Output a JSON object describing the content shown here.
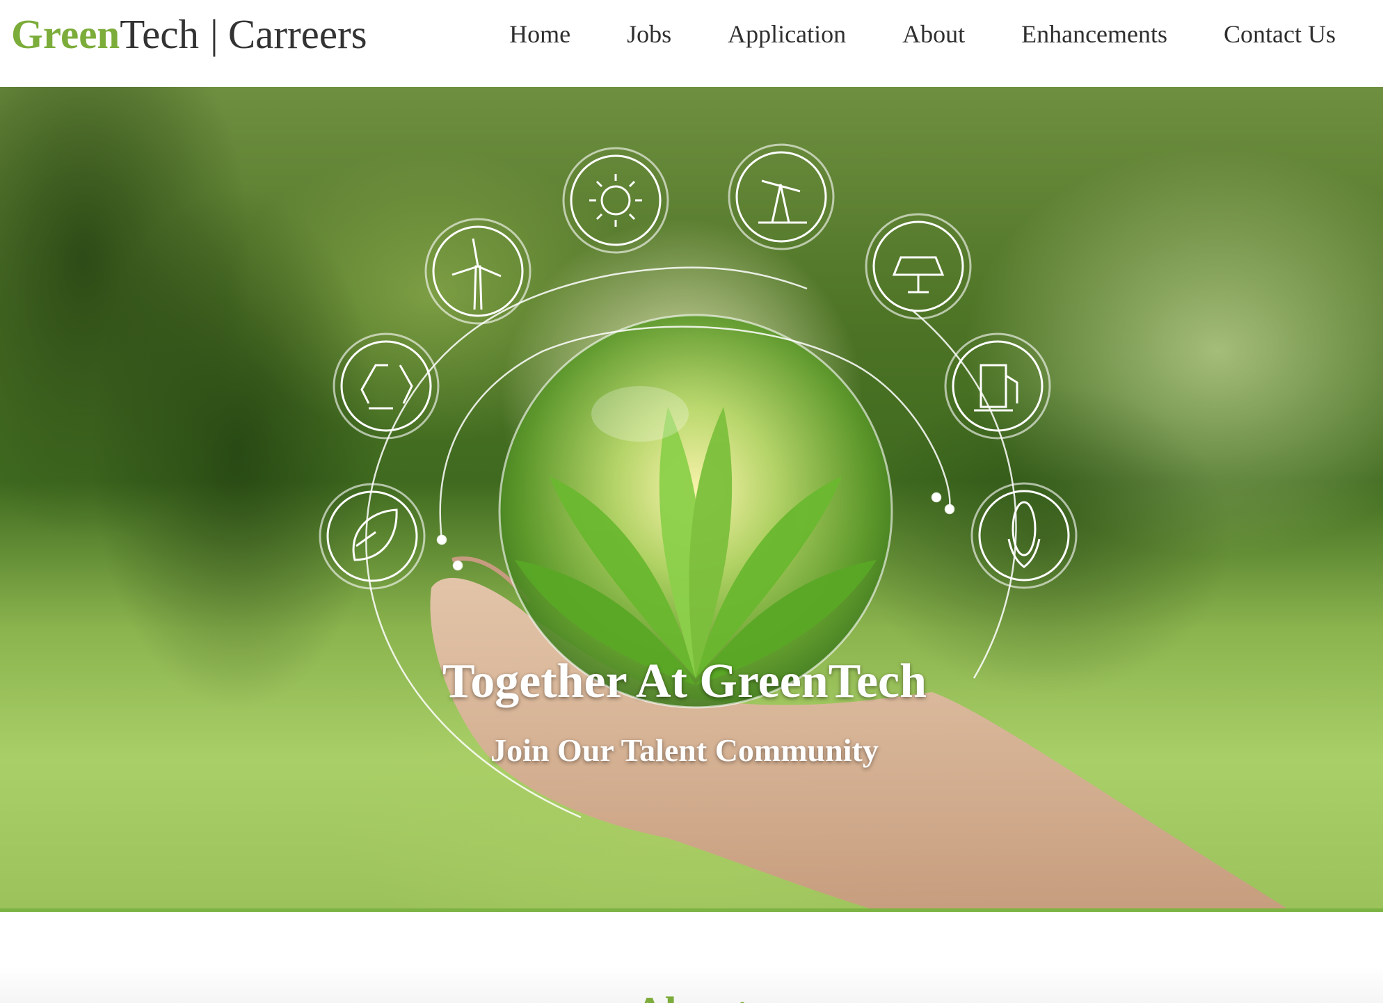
{
  "brand": {
    "name_green": "Green",
    "name_rest": "Tech",
    "separator": "|",
    "careers": "Carreers"
  },
  "nav": {
    "items": [
      {
        "label": "Home"
      },
      {
        "label": "Jobs"
      },
      {
        "label": "Application"
      },
      {
        "label": "About"
      },
      {
        "label": "Enhancements"
      },
      {
        "label": "Contact Us"
      }
    ]
  },
  "hero": {
    "title": "Together At GreenTech",
    "subtitle": "Join Our Talent Community",
    "icons": [
      "leaf-drop-icon",
      "recycle-icon",
      "wind-turbine-icon",
      "sun-icon",
      "oil-pump-icon",
      "solar-panel-icon",
      "fuel-pump-icon",
      "corn-icon"
    ]
  },
  "about": {
    "heading": "About"
  },
  "colors": {
    "brand_green": "#7cac3a",
    "accent_bar": "#7cb342",
    "text_dark": "#333333"
  }
}
